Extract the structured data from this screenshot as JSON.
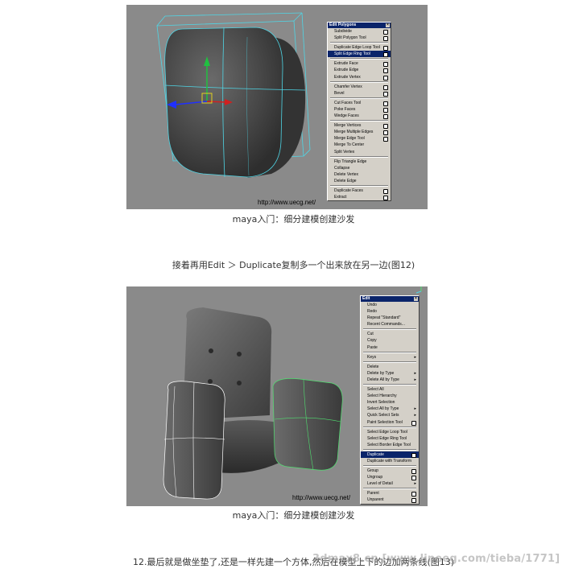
{
  "figure1": {
    "url": "http://www.uecg.net/",
    "caption": "maya入门：细分建模创建沙发",
    "menu": {
      "title": "Edit Polygons",
      "close_icon": "close-icon",
      "groups": [
        [
          {
            "label": "Subdivide",
            "opt": true
          },
          {
            "label": "Split Polygon Tool",
            "opt": true
          }
        ],
        [
          {
            "label": "Duplicate Edge Loop Tool",
            "opt": true
          },
          {
            "label": "Split Edge Ring Tool",
            "opt": true,
            "selected": true
          }
        ],
        [
          {
            "label": "Extrude Face",
            "opt": true
          },
          {
            "label": "Extrude Edge",
            "opt": true
          },
          {
            "label": "Extrude Vertex",
            "opt": true
          }
        ],
        [
          {
            "label": "Chamfer Vertex",
            "opt": true
          },
          {
            "label": "Bevel",
            "opt": true
          }
        ],
        [
          {
            "label": "Cut Faces Tool",
            "opt": true
          },
          {
            "label": "Poke Faces",
            "opt": true
          },
          {
            "label": "Wedge Faces",
            "opt": true
          }
        ],
        [
          {
            "label": "Merge Vertices",
            "opt": true
          },
          {
            "label": "Merge Multiple Edges",
            "opt": true
          },
          {
            "label": "Merge Edge Tool",
            "opt": true
          },
          {
            "label": "Merge To Center"
          },
          {
            "label": "Split Vertex"
          }
        ],
        [
          {
            "label": "Flip Triangle Edge"
          },
          {
            "label": "Collapse"
          },
          {
            "label": "Delete Vertex"
          },
          {
            "label": "Delete Edge"
          }
        ],
        [
          {
            "label": "Duplicate Faces",
            "opt": true
          },
          {
            "label": "Extract",
            "opt": true
          }
        ]
      ]
    }
  },
  "paragraph1": "接着再用Edit ＞ Duplicate复制多一个出来放在另一边(图12)",
  "figure2": {
    "url": "http://www.uecg.net/",
    "caption": "maya入门：细分建模创建沙发",
    "menu": {
      "title": "Edit",
      "close_icon": "close-icon",
      "groups": [
        [
          {
            "label": "Undo"
          },
          {
            "label": "Redo"
          },
          {
            "label": "Repeat \"Standard\""
          },
          {
            "label": "Recent Commands..."
          }
        ],
        [
          {
            "label": "Cut"
          },
          {
            "label": "Copy"
          },
          {
            "label": "Paste"
          }
        ],
        [
          {
            "label": "Keys",
            "arrow": true
          }
        ],
        [
          {
            "label": "Delete"
          },
          {
            "label": "Delete by Type",
            "arrow": true
          },
          {
            "label": "Delete All by Type",
            "arrow": true
          }
        ],
        [
          {
            "label": "Select All"
          },
          {
            "label": "Select Hierarchy"
          },
          {
            "label": "Invert Selection"
          },
          {
            "label": "Select All by Type",
            "arrow": true
          },
          {
            "label": "Quick Select Sets",
            "arrow": true
          },
          {
            "label": "Paint Selection Tool",
            "opt": true
          }
        ],
        [
          {
            "label": "Select Edge Loop Tool"
          },
          {
            "label": "Select Edge Ring Tool"
          },
          {
            "label": "Select Border Edge Tool"
          }
        ],
        [
          {
            "label": "Duplicate",
            "opt": true,
            "selected": true
          },
          {
            "label": "Duplicate with Transform"
          }
        ],
        [
          {
            "label": "Group",
            "opt": true
          },
          {
            "label": "Ungroup",
            "opt": true
          },
          {
            "label": "Level of Detail",
            "arrow": true
          }
        ],
        [
          {
            "label": "Parent",
            "opt": true
          },
          {
            "label": "Unparent",
            "opt": true
          }
        ]
      ]
    }
  },
  "paragraph2": "12.最后就是做坐垫了,还是一样先建一个方体,然后在模型上下的边加两条线(图13)",
  "watermark": "3dmax8.cn  [www.lineeg.com/tieba/1771]"
}
